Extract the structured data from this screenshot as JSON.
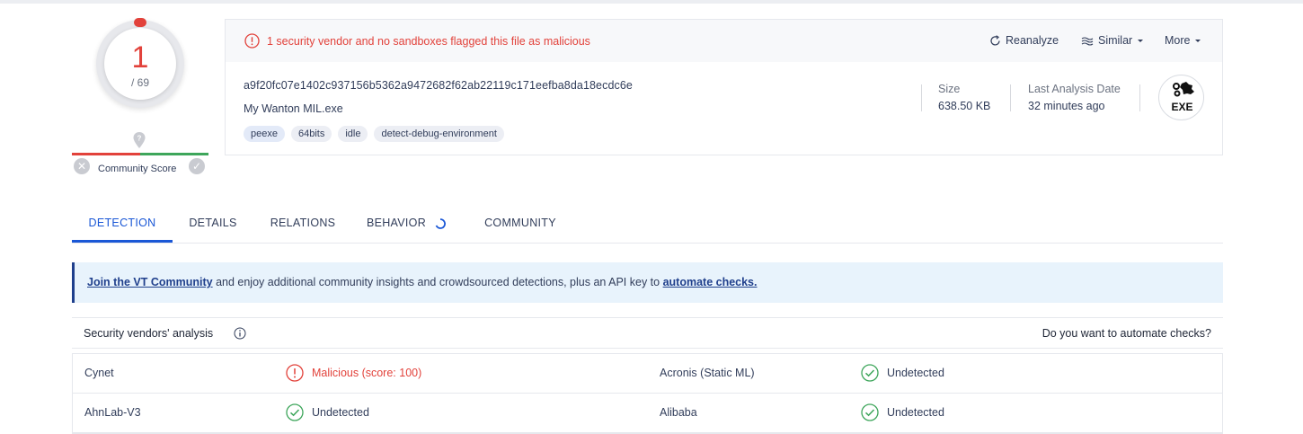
{
  "score": {
    "detections": "1",
    "total": "/ 69",
    "community_label": "Community Score"
  },
  "alert": {
    "text": "1 security vendor and no sandboxes flagged this file as malicious"
  },
  "actions": {
    "reanalyze": "Reanalyze",
    "similar": "Similar",
    "more": "More"
  },
  "file": {
    "hash": "a9f20fc07e1402c937156b5362a9472682f62ab22119c171eefba8da18ecdc6e",
    "name": "My Wanton MIL.exe",
    "tags": [
      "peexe",
      "64bits",
      "idle",
      "detect-debug-environment"
    ],
    "size_label": "Size",
    "size_value": "638.50 KB",
    "date_label": "Last Analysis Date",
    "date_value": "32 minutes ago",
    "type_badge": "EXE"
  },
  "tabs": [
    "DETECTION",
    "DETAILS",
    "RELATIONS",
    "BEHAVIOR",
    "COMMUNITY"
  ],
  "banner": {
    "link1": "Join the VT Community",
    "middle": " and enjoy additional community insights and crowdsourced detections, plus an API key to ",
    "link2": "automate checks."
  },
  "vendors": {
    "title": "Security vendors' analysis",
    "automate": "Do you want to automate checks?",
    "rows": [
      {
        "left_name": "Cynet",
        "left_result": "Malicious (score: 100)",
        "right_name": "Acronis (Static ML)",
        "right_result": "Undetected"
      },
      {
        "left_name": "AhnLab-V3",
        "left_result": "Undetected",
        "right_name": "Alibaba",
        "right_result": "Undetected"
      }
    ]
  },
  "colors": {
    "malicious": "#e2423b",
    "clean": "#3ea65b",
    "accent": "#1a57d6"
  }
}
